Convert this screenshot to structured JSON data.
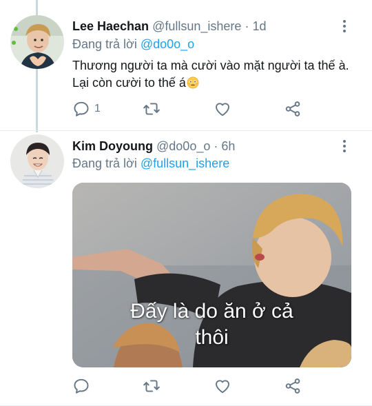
{
  "tweets": [
    {
      "name": "Lee Haechan",
      "handle": "@fullsun_ishere",
      "separator": "·",
      "time": "1d",
      "reply_prefix": "Đang trả lời",
      "reply_handle": "@do0o_o",
      "text": "Thương người ta mà cười vào mặt người ta thế à. Lại còn cười to thế á",
      "emoji": "flushed-face",
      "reply_count": "1"
    },
    {
      "name": "Kim Doyoung",
      "handle": "@do0o_o",
      "separator": "·",
      "time": "6h",
      "reply_prefix": "Đang trả lời",
      "reply_handle": "@fullsun_ishere",
      "media_caption_line1": "Đấy là do ăn ở cả",
      "media_caption_line2": "thôi"
    }
  ],
  "icons": {
    "reply": "speech-bubble-icon",
    "retweet": "retweet-arrows-icon",
    "like": "heart-outline-icon",
    "share": "share-nodes-icon",
    "more": "vertical-ellipsis-icon"
  },
  "colors": {
    "link": "#1da1f2",
    "secondary_text": "#657786",
    "primary_text": "#14171a",
    "thread_line": "#ccd6dd"
  }
}
